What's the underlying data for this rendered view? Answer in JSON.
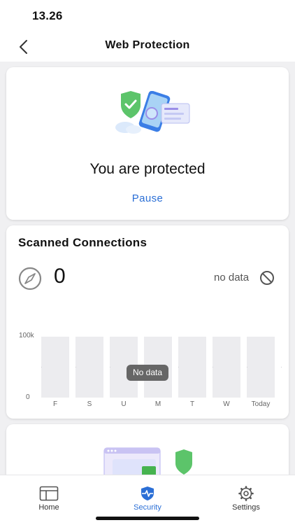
{
  "status_bar": {
    "time": "13.26"
  },
  "nav": {
    "title": "Web Protection",
    "back_icon": "chevron-left-icon"
  },
  "protection_card": {
    "status_text": "You are protected",
    "pause_label": "Pause",
    "illustration": "shield-phone-illustration"
  },
  "scanned_card": {
    "title": "Scanned Connections",
    "count": "0",
    "no_data_label": "no data",
    "chart_overlay": "No data"
  },
  "chart_data": {
    "type": "bar",
    "categories": [
      "F",
      "S",
      "U",
      "M",
      "T",
      "W",
      "Today"
    ],
    "values": [
      null,
      null,
      null,
      null,
      null,
      null,
      null
    ],
    "y_tick_labels": [
      "100k",
      "0"
    ],
    "ylim": [
      0,
      100000
    ]
  },
  "tabs": [
    {
      "label": "Home",
      "icon": "home-icon",
      "active": false
    },
    {
      "label": "Security",
      "icon": "shield-pulse-icon",
      "active": true
    },
    {
      "label": "Settings",
      "icon": "gear-icon",
      "active": false
    }
  ],
  "colors": {
    "accent": "#2b6fd6",
    "shield_green": "#5cc46a"
  }
}
